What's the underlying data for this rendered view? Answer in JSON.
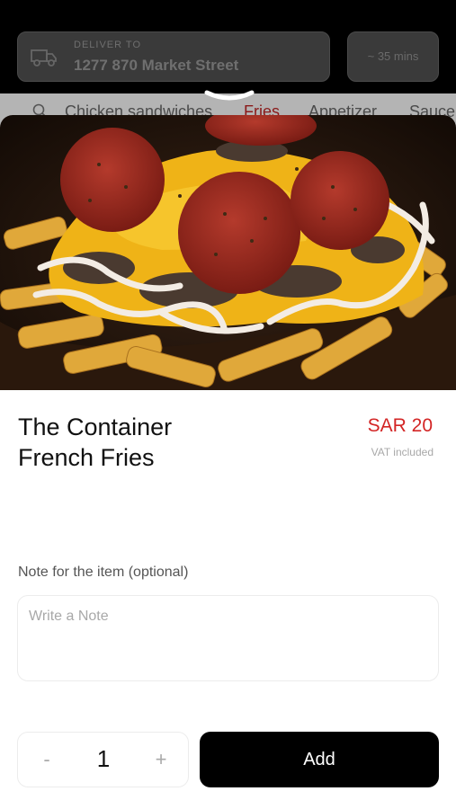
{
  "background": {
    "delivery_label": "DELIVER TO",
    "delivery_address": "1277 870 Market Street",
    "delivery_time": "~ 35 mins",
    "categories": [
      {
        "label": "Chicken sandwiches",
        "active": false
      },
      {
        "label": "Fries",
        "active": true
      },
      {
        "label": "Appetizer",
        "active": false
      },
      {
        "label": "Sauce",
        "active": false
      }
    ]
  },
  "item": {
    "name_line1": "The Container",
    "name_line2": "French Fries",
    "price": "SAR 20",
    "vat_note": "VAT included",
    "image_icon": "loaded-fries-photo"
  },
  "note": {
    "label": "Note for the item (optional)",
    "placeholder": "Write a Note",
    "value": ""
  },
  "order": {
    "quantity": "1",
    "minus_label": "-",
    "plus_label": "+",
    "add_label": "Add"
  },
  "colors": {
    "price": "#d32525",
    "add_button": "#000000",
    "active_category": "#8a1a1a"
  }
}
